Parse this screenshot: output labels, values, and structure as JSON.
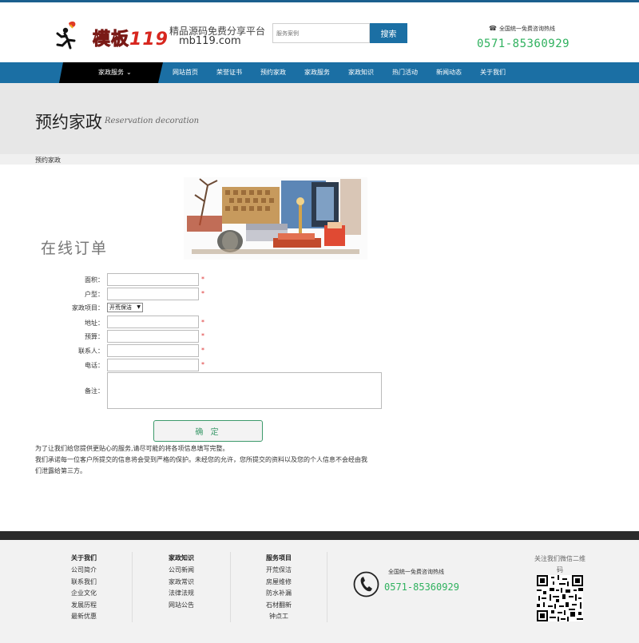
{
  "header": {
    "brand": "模板",
    "brand_num": "119",
    "slogan": "精品源码免费分享平台",
    "domain": "mb119.com",
    "search_placeholder": "服务案例",
    "search_button": "搜索",
    "hotline_label": "全国统一免费咨询热线",
    "hotline_number": "0571-85360929"
  },
  "nav": {
    "home": "家政服务",
    "items": [
      "网站首页",
      "荣誉证书",
      "预约家政",
      "家政服务",
      "家政知识",
      "热门活动",
      "新闻动态",
      "关于我们"
    ]
  },
  "banner": {
    "title": "预约家政",
    "subtitle": "Reservation decoration"
  },
  "breadcrumb": "预约家政",
  "order": {
    "title": "在线订单",
    "fields": {
      "area": "面积：",
      "layout": "户型：",
      "service": "家政项目：",
      "address": "地址：",
      "budget": "预算：",
      "contact": "联系人：",
      "phone": "电话：",
      "remark": "备注："
    },
    "required_mark": "*",
    "service_selected": "开荒保洁",
    "submit": "确 定",
    "note1": "为了让我们给您提供更贴心的服务,请尽可能的将各项信息填写完整。",
    "note2": "我们承诺每一位客户所提交的信息将会受到严格的保护。未经您的允许，您所提交的资料以及您的个人信息不会经由我",
    "note3": "们泄露给第三方。"
  },
  "footer": {
    "col1": {
      "title": "关于我们",
      "links": [
        "公司简介",
        "联系我们",
        "企业文化",
        "发展历程",
        "最新优惠"
      ]
    },
    "col2": {
      "title": "家政知识",
      "links": [
        "公司新闻",
        "家政常识",
        "法律法规",
        "网站公告"
      ]
    },
    "col3": {
      "title": "服务项目",
      "links": [
        "开荒保洁",
        "房屋维修",
        "防水补漏",
        "石材翻新",
        "钟点工"
      ]
    },
    "hotline_label": "全国统一免费咨询热线",
    "hotline_number": "0571-85360929",
    "wechat": "关注我们微信二维码"
  },
  "colors": {
    "nav_blue": "#1b6fa4",
    "hotline_green": "#2fb15e",
    "required_red": "#dd3333"
  }
}
